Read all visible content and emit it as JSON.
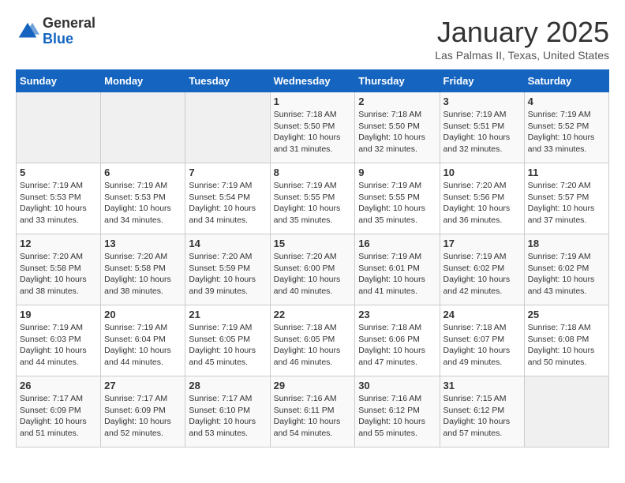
{
  "header": {
    "logo_general": "General",
    "logo_blue": "Blue",
    "title": "January 2025",
    "subtitle": "Las Palmas II, Texas, United States"
  },
  "weekdays": [
    "Sunday",
    "Monday",
    "Tuesday",
    "Wednesday",
    "Thursday",
    "Friday",
    "Saturday"
  ],
  "weeks": [
    [
      {
        "day": "",
        "sunrise": "",
        "sunset": "",
        "daylight": ""
      },
      {
        "day": "",
        "sunrise": "",
        "sunset": "",
        "daylight": ""
      },
      {
        "day": "",
        "sunrise": "",
        "sunset": "",
        "daylight": ""
      },
      {
        "day": "1",
        "sunrise": "Sunrise: 7:18 AM",
        "sunset": "Sunset: 5:50 PM",
        "daylight": "Daylight: 10 hours and 31 minutes."
      },
      {
        "day": "2",
        "sunrise": "Sunrise: 7:18 AM",
        "sunset": "Sunset: 5:50 PM",
        "daylight": "Daylight: 10 hours and 32 minutes."
      },
      {
        "day": "3",
        "sunrise": "Sunrise: 7:19 AM",
        "sunset": "Sunset: 5:51 PM",
        "daylight": "Daylight: 10 hours and 32 minutes."
      },
      {
        "day": "4",
        "sunrise": "Sunrise: 7:19 AM",
        "sunset": "Sunset: 5:52 PM",
        "daylight": "Daylight: 10 hours and 33 minutes."
      }
    ],
    [
      {
        "day": "5",
        "sunrise": "Sunrise: 7:19 AM",
        "sunset": "Sunset: 5:53 PM",
        "daylight": "Daylight: 10 hours and 33 minutes."
      },
      {
        "day": "6",
        "sunrise": "Sunrise: 7:19 AM",
        "sunset": "Sunset: 5:53 PM",
        "daylight": "Daylight: 10 hours and 34 minutes."
      },
      {
        "day": "7",
        "sunrise": "Sunrise: 7:19 AM",
        "sunset": "Sunset: 5:54 PM",
        "daylight": "Daylight: 10 hours and 34 minutes."
      },
      {
        "day": "8",
        "sunrise": "Sunrise: 7:19 AM",
        "sunset": "Sunset: 5:55 PM",
        "daylight": "Daylight: 10 hours and 35 minutes."
      },
      {
        "day": "9",
        "sunrise": "Sunrise: 7:19 AM",
        "sunset": "Sunset: 5:55 PM",
        "daylight": "Daylight: 10 hours and 35 minutes."
      },
      {
        "day": "10",
        "sunrise": "Sunrise: 7:20 AM",
        "sunset": "Sunset: 5:56 PM",
        "daylight": "Daylight: 10 hours and 36 minutes."
      },
      {
        "day": "11",
        "sunrise": "Sunrise: 7:20 AM",
        "sunset": "Sunset: 5:57 PM",
        "daylight": "Daylight: 10 hours and 37 minutes."
      }
    ],
    [
      {
        "day": "12",
        "sunrise": "Sunrise: 7:20 AM",
        "sunset": "Sunset: 5:58 PM",
        "daylight": "Daylight: 10 hours and 38 minutes."
      },
      {
        "day": "13",
        "sunrise": "Sunrise: 7:20 AM",
        "sunset": "Sunset: 5:58 PM",
        "daylight": "Daylight: 10 hours and 38 minutes."
      },
      {
        "day": "14",
        "sunrise": "Sunrise: 7:20 AM",
        "sunset": "Sunset: 5:59 PM",
        "daylight": "Daylight: 10 hours and 39 minutes."
      },
      {
        "day": "15",
        "sunrise": "Sunrise: 7:20 AM",
        "sunset": "Sunset: 6:00 PM",
        "daylight": "Daylight: 10 hours and 40 minutes."
      },
      {
        "day": "16",
        "sunrise": "Sunrise: 7:19 AM",
        "sunset": "Sunset: 6:01 PM",
        "daylight": "Daylight: 10 hours and 41 minutes."
      },
      {
        "day": "17",
        "sunrise": "Sunrise: 7:19 AM",
        "sunset": "Sunset: 6:02 PM",
        "daylight": "Daylight: 10 hours and 42 minutes."
      },
      {
        "day": "18",
        "sunrise": "Sunrise: 7:19 AM",
        "sunset": "Sunset: 6:02 PM",
        "daylight": "Daylight: 10 hours and 43 minutes."
      }
    ],
    [
      {
        "day": "19",
        "sunrise": "Sunrise: 7:19 AM",
        "sunset": "Sunset: 6:03 PM",
        "daylight": "Daylight: 10 hours and 44 minutes."
      },
      {
        "day": "20",
        "sunrise": "Sunrise: 7:19 AM",
        "sunset": "Sunset: 6:04 PM",
        "daylight": "Daylight: 10 hours and 44 minutes."
      },
      {
        "day": "21",
        "sunrise": "Sunrise: 7:19 AM",
        "sunset": "Sunset: 6:05 PM",
        "daylight": "Daylight: 10 hours and 45 minutes."
      },
      {
        "day": "22",
        "sunrise": "Sunrise: 7:18 AM",
        "sunset": "Sunset: 6:05 PM",
        "daylight": "Daylight: 10 hours and 46 minutes."
      },
      {
        "day": "23",
        "sunrise": "Sunrise: 7:18 AM",
        "sunset": "Sunset: 6:06 PM",
        "daylight": "Daylight: 10 hours and 47 minutes."
      },
      {
        "day": "24",
        "sunrise": "Sunrise: 7:18 AM",
        "sunset": "Sunset: 6:07 PM",
        "daylight": "Daylight: 10 hours and 49 minutes."
      },
      {
        "day": "25",
        "sunrise": "Sunrise: 7:18 AM",
        "sunset": "Sunset: 6:08 PM",
        "daylight": "Daylight: 10 hours and 50 minutes."
      }
    ],
    [
      {
        "day": "26",
        "sunrise": "Sunrise: 7:17 AM",
        "sunset": "Sunset: 6:09 PM",
        "daylight": "Daylight: 10 hours and 51 minutes."
      },
      {
        "day": "27",
        "sunrise": "Sunrise: 7:17 AM",
        "sunset": "Sunset: 6:09 PM",
        "daylight": "Daylight: 10 hours and 52 minutes."
      },
      {
        "day": "28",
        "sunrise": "Sunrise: 7:17 AM",
        "sunset": "Sunset: 6:10 PM",
        "daylight": "Daylight: 10 hours and 53 minutes."
      },
      {
        "day": "29",
        "sunrise": "Sunrise: 7:16 AM",
        "sunset": "Sunset: 6:11 PM",
        "daylight": "Daylight: 10 hours and 54 minutes."
      },
      {
        "day": "30",
        "sunrise": "Sunrise: 7:16 AM",
        "sunset": "Sunset: 6:12 PM",
        "daylight": "Daylight: 10 hours and 55 minutes."
      },
      {
        "day": "31",
        "sunrise": "Sunrise: 7:15 AM",
        "sunset": "Sunset: 6:12 PM",
        "daylight": "Daylight: 10 hours and 57 minutes."
      },
      {
        "day": "",
        "sunrise": "",
        "sunset": "",
        "daylight": ""
      }
    ]
  ]
}
